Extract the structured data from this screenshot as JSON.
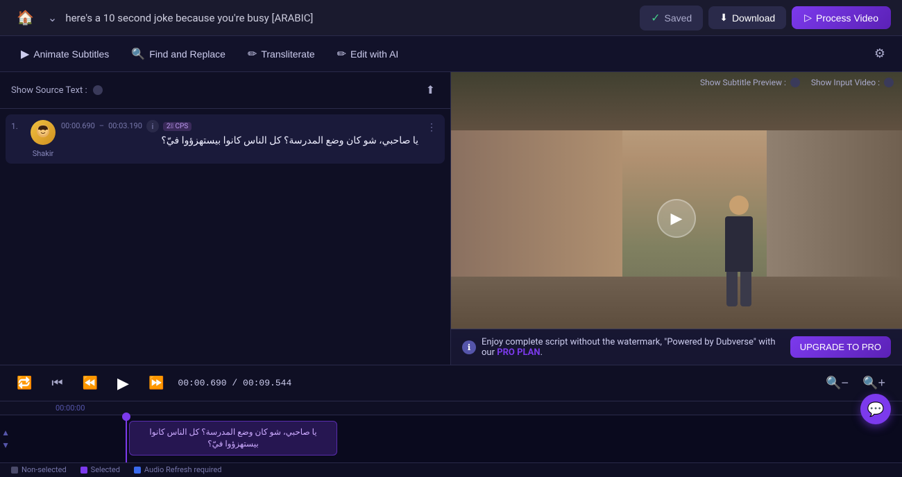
{
  "app": {
    "title": "here's a 10 second joke because you're busy  [ARABIC]"
  },
  "topnav": {
    "home_icon": "🏠",
    "chevron_icon": "⌄",
    "saved_label": "Saved",
    "download_label": "Download",
    "process_label": "Process Video"
  },
  "toolbar": {
    "animate_icon": "▶",
    "animate_label": "Animate Subtitles",
    "find_icon": "🔍",
    "find_label": "Find and Replace",
    "transliterate_icon": "✏",
    "transliterate_label": "Transliterate",
    "edit_icon": "✏",
    "edit_label": "Edit with AI",
    "settings_icon": "⚙"
  },
  "left_panel": {
    "source_text_label": "Show Source Text :",
    "subtitle_items": [
      {
        "number": "1.",
        "time_start": "00:00.690",
        "time_end": "00:03.190",
        "text": "يا صاحبي، شو كان وضع المدرسة؟ كل الناس كانوا بيستهزؤوا فيّ؟",
        "speaker": "Shakir",
        "has_speaker_tag": true
      }
    ]
  },
  "video_panel": {
    "show_subtitle_preview_label": "Show Subtitle Preview :",
    "show_input_video_label": "Show Input Video :"
  },
  "pro_banner": {
    "description": "Enjoy complete script without the watermark, \"Powered by Dubverse\" with our",
    "pro_plan_label": "PRO PLAN",
    "upgrade_label": "UPGRADE TO PRO"
  },
  "video_controls": {
    "time_current": "00:00.690",
    "time_total": "00:09.544",
    "separator": "/"
  },
  "timeline": {
    "timestamp_label": "00:00:00",
    "subtitle_block_text": "يا صاحبي، شو كان وضع المدرسة؟ كل الناس كانوا بيستهزؤوا فيّ؟"
  },
  "timeline_legend": {
    "items": [
      {
        "color": "grey",
        "label": "Non-selected"
      },
      {
        "color": "purple",
        "label": "Selected"
      },
      {
        "color": "blue",
        "label": "Audio Refresh required"
      }
    ]
  }
}
